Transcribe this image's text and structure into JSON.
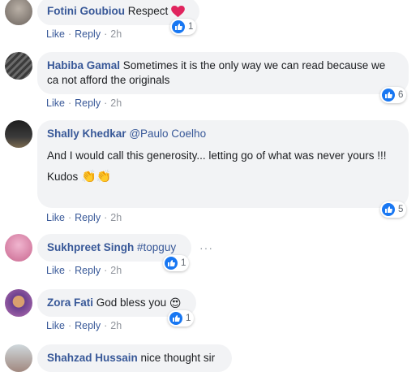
{
  "comments": [
    {
      "author": "Fotini Goubiou",
      "text": "Respect",
      "actions": {
        "like": "Like",
        "reply": "Reply",
        "time": "2h"
      },
      "reaction_count": "1"
    },
    {
      "author": "Habiba Gamal",
      "text": "Sometimes it is the only way we can read because we ca not afford the originals",
      "actions": {
        "like": "Like",
        "reply": "Reply",
        "time": "2h"
      },
      "reaction_count": "6"
    },
    {
      "author": "Shally Khedkar",
      "mention": "@Paulo Coelho",
      "text": "And I would call this generosity... letting go of what was never yours !!!",
      "text2": "Kudos",
      "actions": {
        "like": "Like",
        "reply": "Reply",
        "time": "2h"
      },
      "reaction_count": "5"
    },
    {
      "author": "Sukhpreet Singh",
      "text": "#topguy",
      "actions": {
        "like": "Like",
        "reply": "Reply",
        "time": "2h"
      },
      "reaction_count": "1",
      "more": "···"
    },
    {
      "author": "Zora Fati",
      "text": "God bless you",
      "actions": {
        "like": "Like",
        "reply": "Reply",
        "time": "2h"
      },
      "reaction_count": "1"
    },
    {
      "author": "Shahzad Hussain",
      "text": "nice thought sir"
    }
  ],
  "colors": {
    "link": "#385898",
    "bubble": "#f2f3f5",
    "like_blue": "#1877f2",
    "muted": "#90949c"
  },
  "icons": [
    "red-heart-emoji",
    "clapping-hands-emoji",
    "heart-eyes-emoji",
    "like-thumb-icon"
  ]
}
